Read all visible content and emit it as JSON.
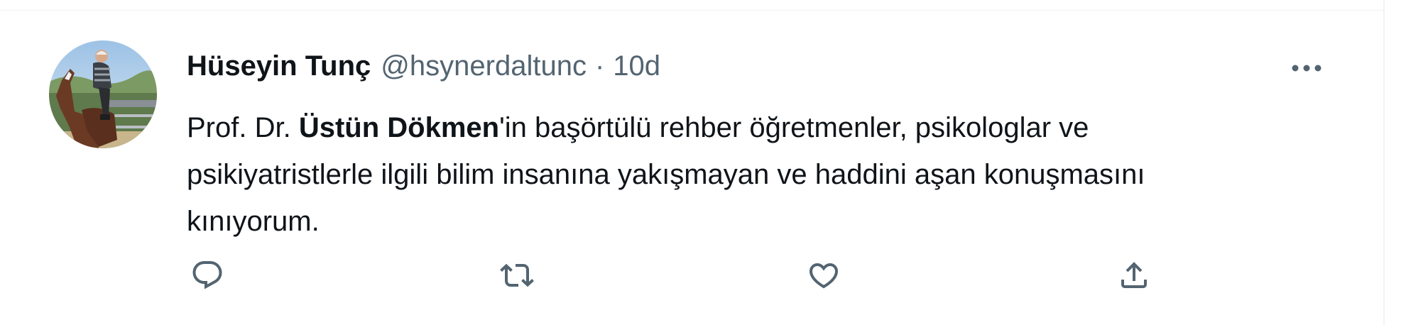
{
  "tweet": {
    "author": {
      "display_name": "Hüseyin Tunç",
      "handle": "@hsynerdaltunc",
      "avatar_icon": "user-avatar-photo"
    },
    "separator": "·",
    "timestamp": "10d",
    "text": {
      "line1_prefix": "Prof. Dr. ",
      "line1_mention": "Üstün Dökmen",
      "line1_suffix": "'in başörtülü rehber öğretmenler, psikologlar ve",
      "line2": "psikiyatristlerle ilgili bilim insanına yakışmayan ve haddini aşan konuşmasını",
      "line3": "kınıyorum."
    },
    "actions": [
      {
        "name": "reply",
        "icon": "reply-icon"
      },
      {
        "name": "retweet",
        "icon": "retweet-icon"
      },
      {
        "name": "like",
        "icon": "heart-icon"
      },
      {
        "name": "share",
        "icon": "share-icon"
      }
    ],
    "more_icon": "more-options-icon"
  },
  "colors": {
    "primary_text": "#0f1419",
    "secondary_text": "#536471",
    "border": "#eff3f4"
  }
}
